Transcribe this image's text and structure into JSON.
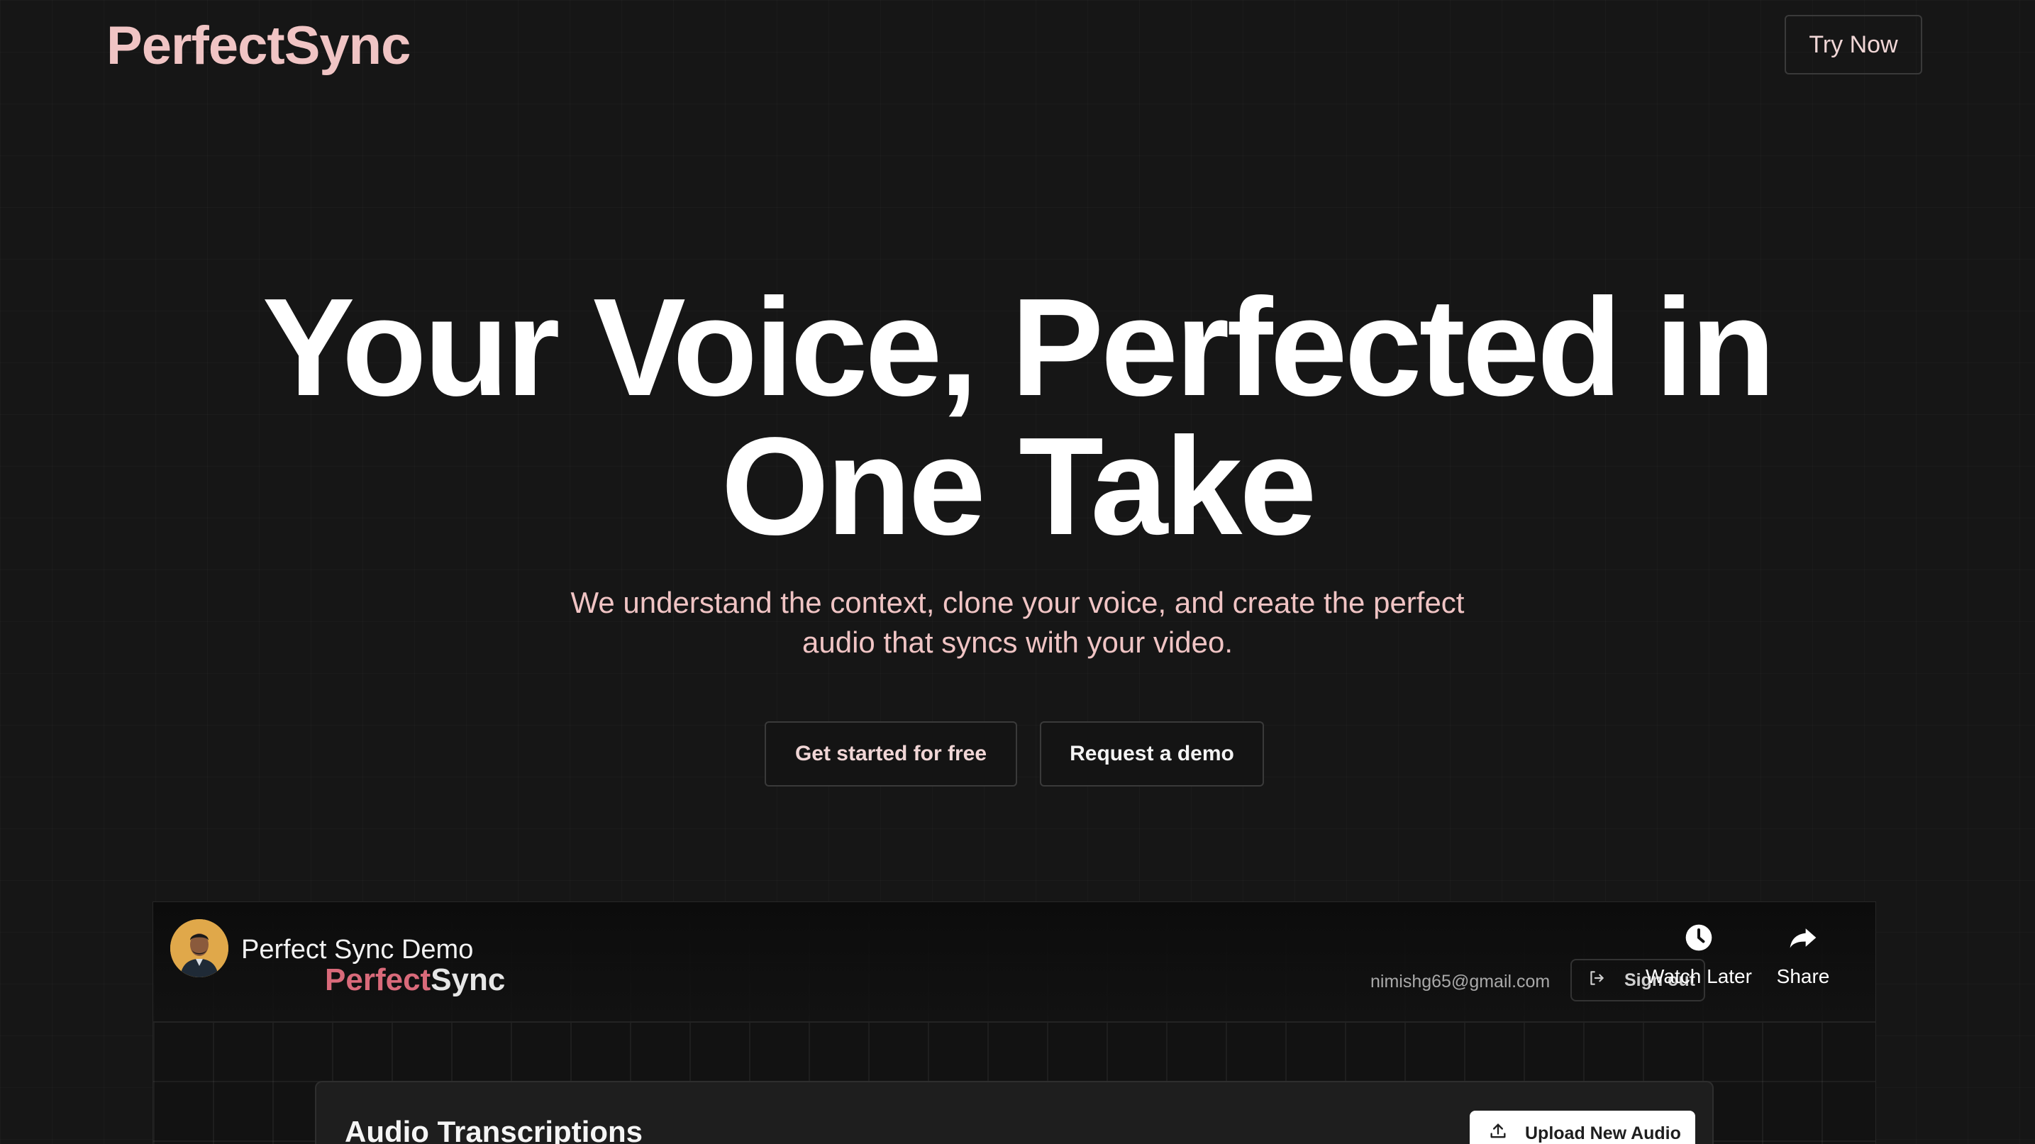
{
  "header": {
    "logo": "PerfectSync",
    "try_now_label": "Try Now"
  },
  "hero": {
    "title_line1": "Your Voice, Perfected in",
    "title_line2": "One Take",
    "subtitle_line1": "We understand the context, clone your voice, and create the perfect",
    "subtitle_line2": "audio that syncs with your video.",
    "cta_primary": "Get started for free",
    "cta_secondary": "Request a demo"
  },
  "video": {
    "title": "Perfect Sync Demo",
    "watch_later_label": "Watch Later",
    "share_label": "Share",
    "inner_app": {
      "logo_part1": "Perfect",
      "logo_part2": "Sync",
      "email": "nimishg65@gmail.com",
      "signout_label": "Sign out",
      "card_title": "Audio Transcriptions",
      "upload_label": "Upload New Audio"
    }
  },
  "colors": {
    "background": "#161616",
    "accent_pink": "#f0c4c4",
    "inner_logo_pink": "#d96a7a",
    "text_white": "#ffffff"
  },
  "icons": [
    "clock-icon",
    "share-arrow-icon",
    "sign-out-icon",
    "upload-icon",
    "avatar"
  ]
}
